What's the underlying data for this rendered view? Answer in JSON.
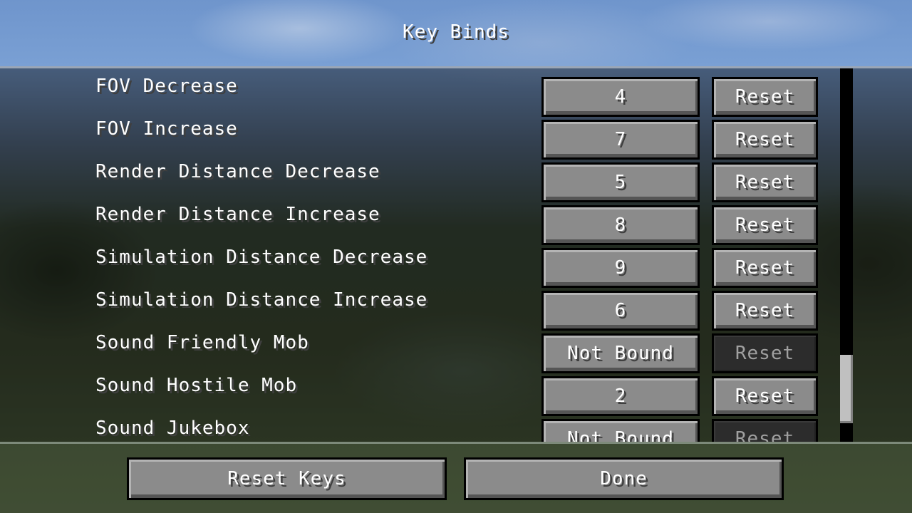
{
  "window": {
    "title": "Key Binds"
  },
  "keybinds": [
    {
      "label": "FOV Decrease",
      "key": "4",
      "reset_label": "Reset",
      "reset_enabled": true
    },
    {
      "label": "FOV Increase",
      "key": "7",
      "reset_label": "Reset",
      "reset_enabled": true
    },
    {
      "label": "Render Distance Decrease",
      "key": "5",
      "reset_label": "Reset",
      "reset_enabled": true
    },
    {
      "label": "Render Distance Increase",
      "key": "8",
      "reset_label": "Reset",
      "reset_enabled": true
    },
    {
      "label": "Simulation Distance Decrease",
      "key": "9",
      "reset_label": "Reset",
      "reset_enabled": true
    },
    {
      "label": "Simulation Distance Increase",
      "key": "6",
      "reset_label": "Reset",
      "reset_enabled": true
    },
    {
      "label": "Sound Friendly Mob",
      "key": "Not Bound",
      "reset_label": "Reset",
      "reset_enabled": false
    },
    {
      "label": "Sound Hostile Mob",
      "key": "2",
      "reset_label": "Reset",
      "reset_enabled": true
    },
    {
      "label": "Sound Jukebox",
      "key": "Not Bound",
      "reset_label": "Reset",
      "reset_enabled": false
    }
  ],
  "scrollbar": {
    "position_fraction": 0.95
  },
  "footer": {
    "reset_keys_label": "Reset Keys",
    "done_label": "Done"
  },
  "colors": {
    "button_face": "#8b8b8b",
    "button_disabled": "#2c2c2c",
    "text": "#ffffff",
    "text_disabled": "#a0a0a0"
  }
}
